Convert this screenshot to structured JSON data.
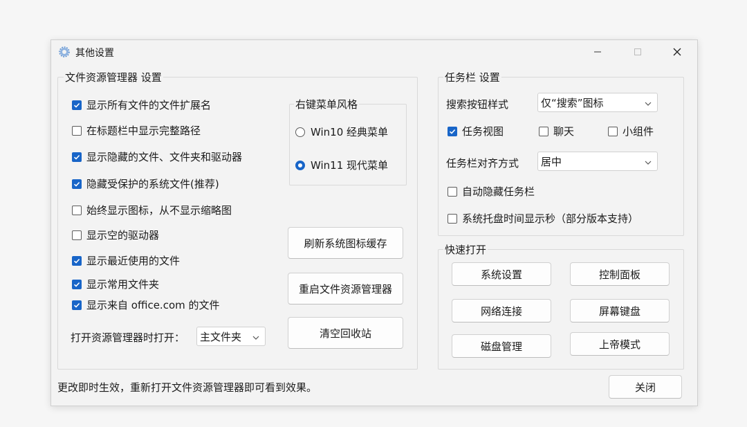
{
  "window": {
    "title": "其他设置",
    "controls": {
      "minimize": "minimize",
      "maximize": "maximize",
      "close": "close"
    }
  },
  "explorer": {
    "legend": "文件资源管理器 设置",
    "options": [
      {
        "label": "显示所有文件的文件扩展名",
        "checked": true
      },
      {
        "label": "在标题栏中显示完整路径",
        "checked": false
      },
      {
        "label": "显示隐藏的文件、文件夹和驱动器",
        "checked": true
      },
      {
        "label": "隐藏受保护的系统文件(推荐)",
        "checked": true
      },
      {
        "label": "始终显示图标，从不显示缩略图",
        "checked": false
      },
      {
        "label": "显示空的驱动器",
        "checked": false
      },
      {
        "label": "显示最近使用的文件",
        "checked": true
      },
      {
        "label": "显示常用文件夹",
        "checked": true
      },
      {
        "label": "显示来自 office.com 的文件",
        "checked": true
      }
    ],
    "open_label": "打开资源管理器时打开：",
    "open_value": "主文件夹"
  },
  "context_menu": {
    "legend": "右键菜单风格",
    "options": [
      {
        "label": "Win10 经典菜单",
        "selected": false
      },
      {
        "label": "Win11 现代菜单",
        "selected": true
      }
    ]
  },
  "actions": {
    "refresh_icons": "刷新系统图标缓存",
    "restart_explorer": "重启文件资源管理器",
    "empty_recycle": "清空回收站"
  },
  "taskbar": {
    "legend": "任务栏 设置",
    "search_label": "搜索按钮样式",
    "search_value": "仅“搜索”图标",
    "task_view": {
      "label": "任务视图",
      "checked": true
    },
    "chat": {
      "label": "聊天",
      "checked": false
    },
    "widgets": {
      "label": "小组件",
      "checked": false
    },
    "align_label": "任务栏对齐方式",
    "align_value": "居中",
    "auto_hide": {
      "label": "自动隐藏任务栏",
      "checked": false
    },
    "seconds": {
      "label": "系统托盘时间显示秒（部分版本支持）",
      "checked": false
    }
  },
  "quick_open": {
    "legend": "快速打开",
    "buttons": [
      "系统设置",
      "控制面板",
      "网络连接",
      "屏幕键盘",
      "磁盘管理",
      "上帝模式"
    ]
  },
  "status_text": "更改即时生效，重新打开文件资源管理器即可看到效果。",
  "close_label": "关闭",
  "colors": {
    "accent": "#1865c8",
    "window_bg": "#f3f3f3"
  }
}
